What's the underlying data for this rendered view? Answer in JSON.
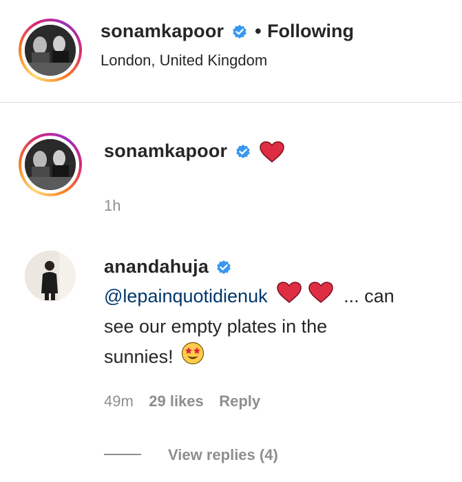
{
  "header": {
    "username": "sonamkapoor",
    "separator": "•",
    "follow_status": "Following",
    "location": "London, United Kingdom"
  },
  "caption": {
    "username": "sonamkapoor",
    "time": "1h",
    "emoji": "red-heart-icon"
  },
  "comment": {
    "username": "anandahuja",
    "mention": "@lepainquotidienuk",
    "text_after_hearts": "... can",
    "line2": "see our empty plates in the",
    "line3": "sunnies!",
    "time": "49m",
    "likes": "29 likes",
    "reply": "Reply",
    "view_replies": "View replies (4)"
  },
  "colors": {
    "verified": "#3897f0",
    "heart": "#dd2e44",
    "divider": "#dbdbdb",
    "meta": "#8e8e8e",
    "mention": "#00376b"
  }
}
